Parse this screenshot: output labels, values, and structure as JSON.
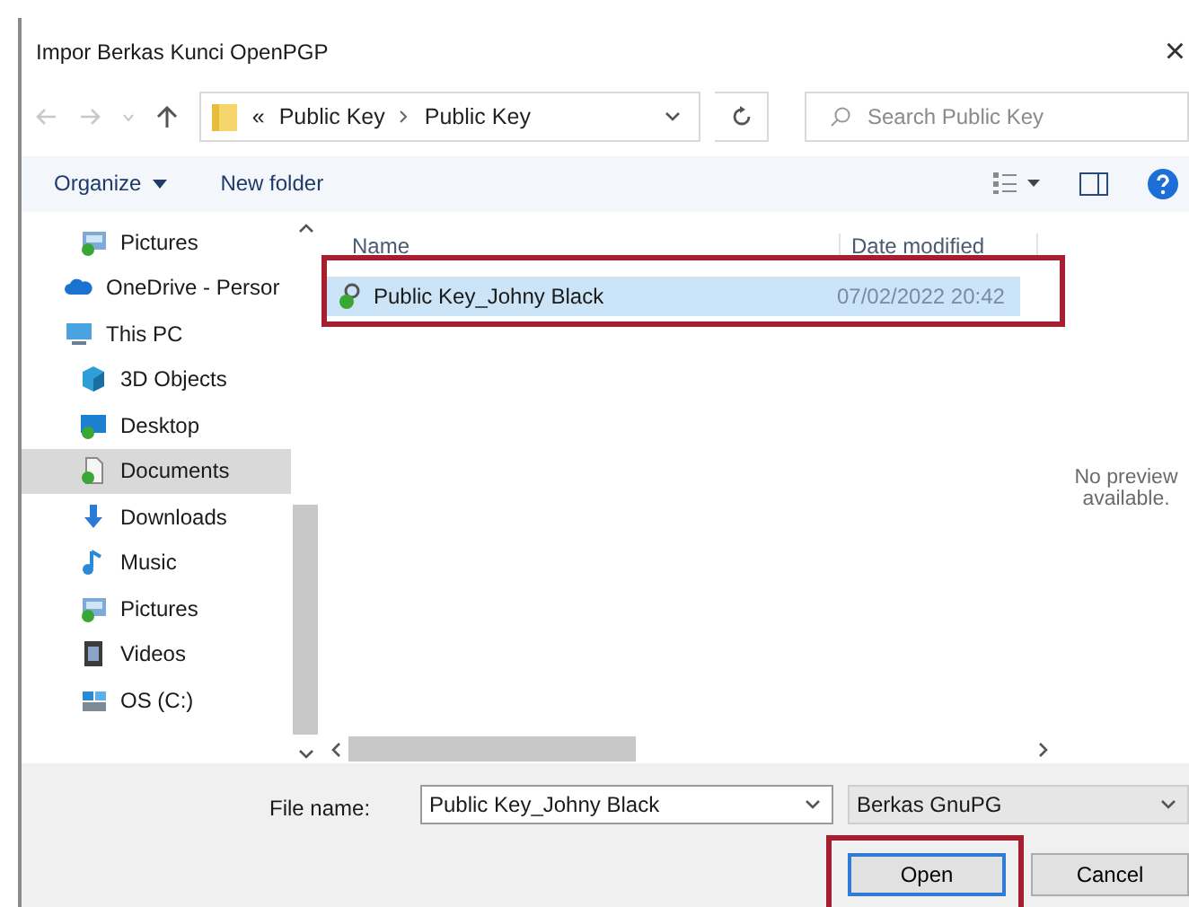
{
  "window": {
    "title": "Impor Berkas Kunci OpenPGP",
    "close": "×"
  },
  "address_bar": {
    "overflow": "«",
    "path": [
      "Public Key",
      "Public Key"
    ]
  },
  "search": {
    "placeholder": "Search Public Key"
  },
  "command_bar": {
    "organize": "Organize",
    "new_folder": "New folder"
  },
  "sidebar": {
    "scrolled_group": [
      {
        "label": "Pictures",
        "kind": "pictures",
        "selected": false
      }
    ],
    "items": [
      {
        "label": "OneDrive - Persor",
        "kind": "cloud",
        "selected": false
      },
      {
        "label": "This PC",
        "kind": "pc",
        "selected": false,
        "children": [
          {
            "label": "3D Objects",
            "kind": "cube",
            "selected": false
          },
          {
            "label": "Desktop",
            "kind": "desktop",
            "selected": false
          },
          {
            "label": "Documents",
            "kind": "documents",
            "selected": true
          },
          {
            "label": "Downloads",
            "kind": "downloads",
            "selected": false
          },
          {
            "label": "Music",
            "kind": "music",
            "selected": false
          },
          {
            "label": "Pictures",
            "kind": "pictures",
            "selected": false
          },
          {
            "label": "Videos",
            "kind": "videos",
            "selected": false
          },
          {
            "label": "OS (C:)",
            "kind": "drive",
            "selected": false
          }
        ]
      }
    ]
  },
  "file_list": {
    "columns": [
      "Name",
      "Date modified"
    ],
    "rows": [
      {
        "name": "Public Key_Johny Black",
        "date": "07/02/2022 20:42",
        "selected": true,
        "annotated": true
      }
    ]
  },
  "preview": {
    "text": "No preview available."
  },
  "footer": {
    "file_name_label": "File name:",
    "file_name": "Public Key_Johny Black",
    "file_type": "Berkas GnuPG",
    "buttons": [
      {
        "label": "Open",
        "default": true,
        "annotated": true
      },
      {
        "label": "Cancel",
        "default": false,
        "annotated": false
      }
    ]
  }
}
